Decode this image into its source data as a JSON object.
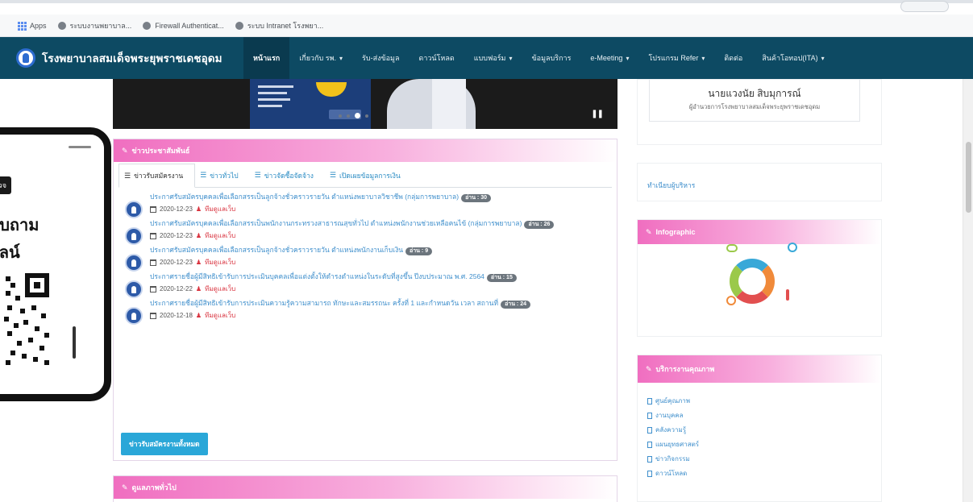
{
  "browser": {
    "bookmarks": [
      {
        "label": "Apps",
        "icon": "apps-grid-icon"
      },
      {
        "label": "ระบบงานพยาบาล...",
        "icon": "globe-icon"
      },
      {
        "label": "Firewall Authenticat...",
        "icon": "globe-icon"
      },
      {
        "label": "ระบบ Intranet โรงพยา...",
        "icon": "globe-icon"
      }
    ]
  },
  "navbar": {
    "brand": "โรงพยาบาลสมเด็จพระยุพราชเดชอุดม",
    "items": [
      {
        "label": "หน้าแรก",
        "active": true,
        "dropdown": false
      },
      {
        "label": "เกี่ยวกับ รพ.",
        "active": false,
        "dropdown": true
      },
      {
        "label": "รับ-ส่งข้อมูล",
        "active": false,
        "dropdown": false
      },
      {
        "label": "ดาวน์โหลด",
        "active": false,
        "dropdown": false
      },
      {
        "label": "แบบฟอร์ม",
        "active": false,
        "dropdown": true
      },
      {
        "label": "ข้อมูลบริการ",
        "active": false,
        "dropdown": false
      },
      {
        "label": "e-Meeting",
        "active": false,
        "dropdown": true
      },
      {
        "label": "โปรแกรม Refer",
        "active": false,
        "dropdown": true
      },
      {
        "label": "ติดต่อ",
        "active": false,
        "dropdown": false
      },
      {
        "label": "สินค้าโอทอป(ITA)",
        "active": false,
        "dropdown": true
      }
    ]
  },
  "phone_ad": {
    "badge": "นัดตรวจ",
    "line1": "สอบถาม",
    "line2": "นไลน์"
  },
  "news": {
    "header": "ข่าวประชาสัมพันธ์",
    "tabs": [
      {
        "label": "ข่าวรับสมัครงาน",
        "active": true
      },
      {
        "label": "ข่าวทั่วไป",
        "active": false
      },
      {
        "label": "ข่าวจัดซื้อจัดจ้าง",
        "active": false
      },
      {
        "label": "เปิดเผยข้อมูลการเงิน",
        "active": false
      }
    ],
    "items": [
      {
        "title": "ประกาศรับสมัครบุคคลเพื่อเลือกสรรเป็นลูกจ้างชั่วคราวรายวัน ตำแหน่งพยาบาลวิชาชีพ (กลุ่มการพยาบาล)",
        "badge": "อ่าน : 30",
        "date": "2020-12-23",
        "author": "ทีมดูแลเว็บ"
      },
      {
        "title": "ประกาศรับสมัครบุคคลเพื่อเลือกสรรเป็นพนักงานกระทรวงสาธารณสุขทั่วไป ตำแหน่งพนักงานช่วยเหลือคนไข้ (กลุ่มการพยาบาล)",
        "badge": "อ่าน : 26",
        "date": "2020-12-23",
        "author": "ทีมดูแลเว็บ"
      },
      {
        "title": "ประกาศรับสมัครบุคคลเพื่อเลือกสรรเป็นลูกจ้างชั่วคราวรายวัน ตำแหน่งพนักงานเก็บเงิน",
        "badge": "อ่าน : 9",
        "date": "2020-12-23",
        "author": "ทีมดูแลเว็บ"
      },
      {
        "title": "ประกาศรายชื่อผู้มีสิทธิเข้ารับการประเมินบุคคลเพื่อแต่งตั้งให้ดำรงตำแหน่งในระดับที่สูงขึ้น ปีงบประมาณ พ.ศ. 2564",
        "badge": "อ่าน : 15",
        "date": "2020-12-22",
        "author": "ทีมดูแลเว็บ"
      },
      {
        "title": "ประกาศรายชื่อผู้มีสิทธิเข้ารับการประเมินความรู้ความสามารถ ทักษะและสมรรถนะ ครั้งที่ 1 และกำหนดวัน เวลา สถานที่",
        "badge": "อ่าน : 24",
        "date": "2020-12-18",
        "author": "ทีมดูแลเว็บ"
      }
    ],
    "all_button": "ข่าวรับสมัครงานทั้งหมด"
  },
  "box2": {
    "header": "ดูแลภาพทั่วไป"
  },
  "sidebar": {
    "quote_name": "นายแวงนัย สิบมุการณ์",
    "quote_org": "ผู้อำนวยการโรงพยาบาลสมเด็จพระยุพราชเดชอุดม",
    "link1": "ทำเนียบผู้บริหาร",
    "infographic_header": "Infographic",
    "services_header": "บริการงานคุณภาพ",
    "links": [
      "ศูนย์คุณภาพ",
      "งานบุคคล",
      "คลังความรู้",
      "แผนยุทธศาสตร์",
      "ข่าวกิจกรรม",
      "ดาวน์โหลด"
    ]
  },
  "colors": {
    "navbar": "#0d4a63",
    "header_gradient_start": "#f06ec0",
    "link": "#3f8fcc",
    "button": "#2aa7d8"
  }
}
